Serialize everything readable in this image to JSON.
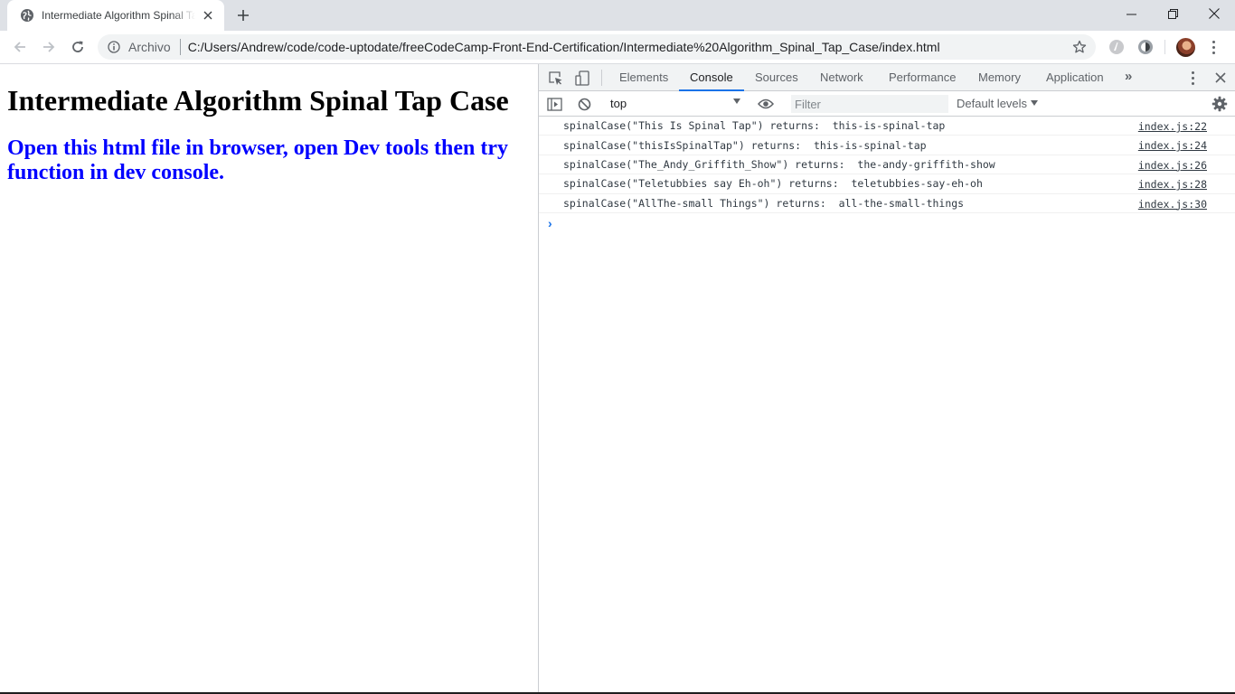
{
  "browser": {
    "tab": {
      "title": "Intermediate Algorithm Spinal Tap Case"
    },
    "address": {
      "security_label": "Archivo",
      "url": "C:/Users/Andrew/code/code-uptodate/freeCodeCamp-Front-End-Certification/Intermediate%20Algorithm_Spinal_Tap_Case/index.html"
    }
  },
  "page": {
    "heading": "Intermediate Algorithm Spinal Tap Case",
    "subheading": "Open this html file in browser, open Dev tools then try function in dev console."
  },
  "devtools": {
    "tabs": [
      {
        "label": "Elements"
      },
      {
        "label": "Console"
      },
      {
        "label": "Sources"
      },
      {
        "label": "Network"
      },
      {
        "label": "Performance"
      },
      {
        "label": "Memory"
      },
      {
        "label": "Application"
      }
    ],
    "active_tab": "Console",
    "toolbar": {
      "context": "top",
      "filter_placeholder": "Filter",
      "levels": "Default levels"
    },
    "console": [
      {
        "message": "spinalCase(\"This Is Spinal Tap\") returns:  this-is-spinal-tap",
        "source": "index.js:22"
      },
      {
        "message": "spinalCase(\"thisIsSpinalTap\") returns:  this-is-spinal-tap",
        "source": "index.js:24"
      },
      {
        "message": "spinalCase(\"The_Andy_Griffith_Show\") returns:  the-andy-griffith-show",
        "source": "index.js:26"
      },
      {
        "message": "spinalCase(\"Teletubbies say Eh-oh\") returns:  teletubbies-say-eh-oh",
        "source": "index.js:28"
      },
      {
        "message": "spinalCase(\"AllThe-small Things\") returns:  all-the-small-things",
        "source": "index.js:30"
      }
    ]
  },
  "colors": {
    "heading": "#000000",
    "subheading": "#0000ff",
    "accent": "#1a73e8",
    "tabstrip": "#dee1e6"
  },
  "icons": {
    "tab_favicon": "globe-icon",
    "tab_close": "close-icon",
    "new_tab": "plus-icon",
    "back": "arrow-left-icon",
    "forward": "arrow-right-icon",
    "reload": "reload-icon",
    "info": "info-icon",
    "bookmark": "star-icon"
  }
}
